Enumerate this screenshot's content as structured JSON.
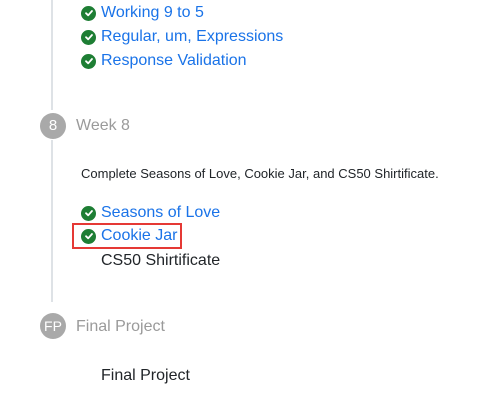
{
  "previous_section": {
    "items": [
      {
        "label": "Working 9 to 5",
        "icon": "check-circle-icon"
      },
      {
        "label": "Regular, um, Expressions",
        "icon": "check-circle-icon"
      },
      {
        "label": "Response Validation",
        "icon": "check-circle-icon"
      }
    ]
  },
  "week8": {
    "badge": "8",
    "title": "Week 8",
    "description": "Complete Seasons of Love, Cookie Jar, and CS50 Shirtificate.",
    "items": [
      {
        "label": "Seasons of Love",
        "icon": "check-circle-icon"
      },
      {
        "label": "Cookie Jar",
        "icon": "check-circle-icon"
      }
    ],
    "pending_item": "CS50 Shirtificate"
  },
  "final_project": {
    "badge": "FP",
    "title": "Final Project",
    "item": "Final Project"
  },
  "colors": {
    "link": "#1a73e8",
    "check": "#1e7e34",
    "badge": "#a9a9a9",
    "highlight": "#e53935"
  }
}
